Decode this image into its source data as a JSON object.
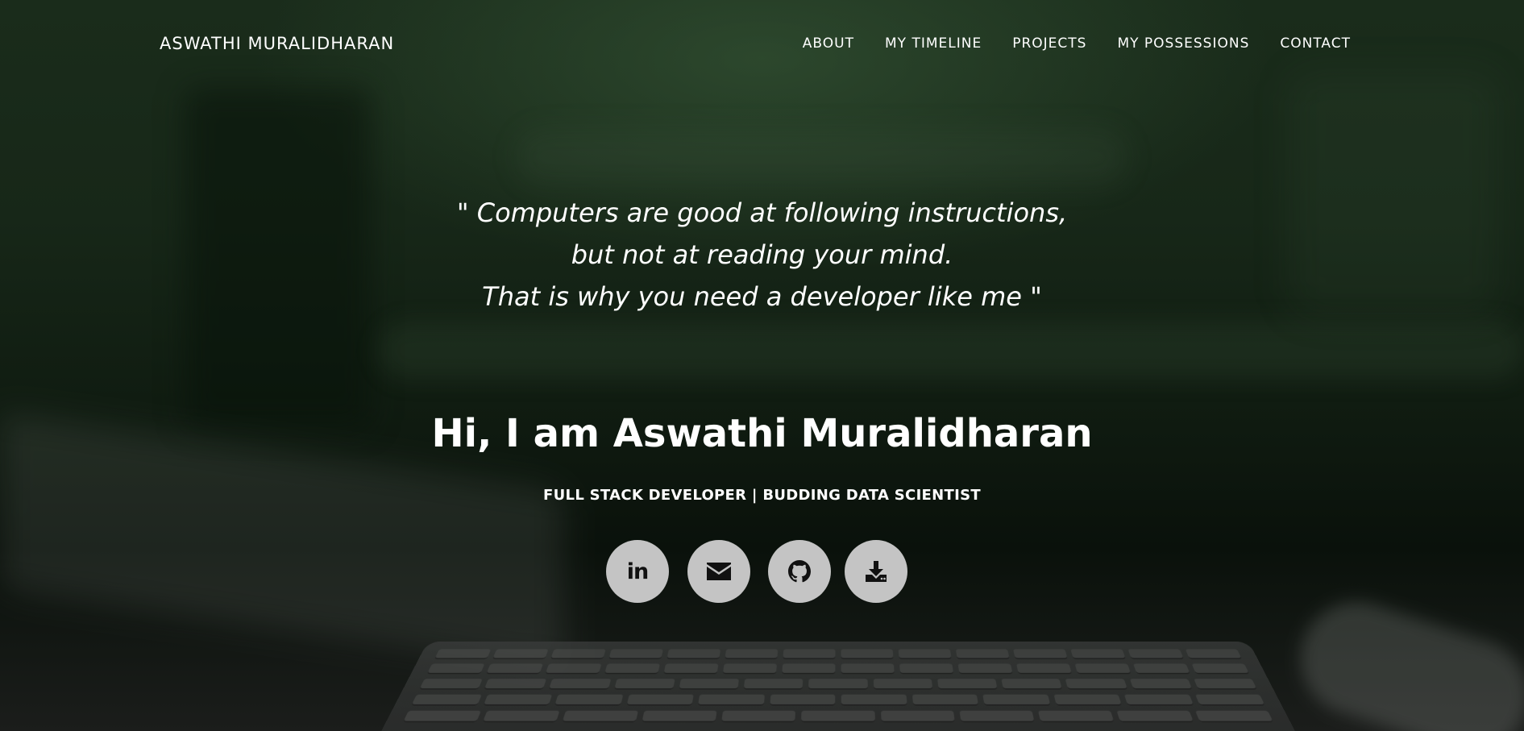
{
  "brand": "ASWATHI MURALIDHARAN",
  "nav": {
    "items": [
      {
        "label": "ABOUT"
      },
      {
        "label": "MY TIMELINE"
      },
      {
        "label": "PROJECTS"
      },
      {
        "label": "MY POSSESSIONS"
      },
      {
        "label": "CONTACT"
      }
    ]
  },
  "hero": {
    "quote_lines": [
      "\" Computers are good at following instructions,",
      "but not at reading your mind.",
      "That is why you need a developer like me \""
    ],
    "heading": "Hi, I am Aswathi Muralidharan",
    "subtitle": "FULL STACK DEVELOPER | BUDDING DATA SCIENTIST"
  },
  "social": {
    "icons": [
      "linkedin-icon",
      "email-icon",
      "github-icon",
      "download-icon"
    ],
    "linkedin_text": "in",
    "button_color": "#c4c4c4",
    "icon_color": "#111111"
  }
}
